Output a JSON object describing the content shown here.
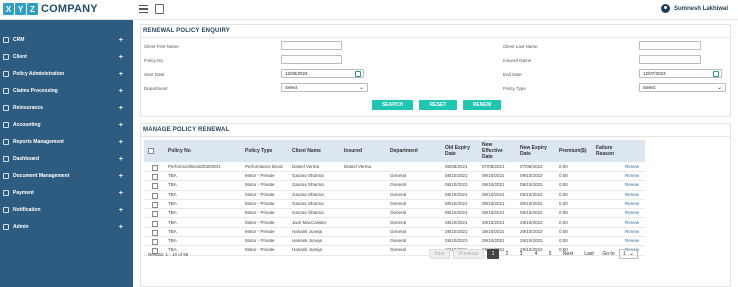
{
  "app": {
    "logo_letters": [
      "X",
      "Y",
      "Z"
    ],
    "logo_text": "COMPANY",
    "user_name": "Sumnesh Lakhiwal"
  },
  "sidebar": {
    "items": [
      {
        "label": "CRM"
      },
      {
        "label": "Client"
      },
      {
        "label": "Policy Administration"
      },
      {
        "label": "Claims Processing"
      },
      {
        "label": "Reinsurance"
      },
      {
        "label": "Accounting"
      },
      {
        "label": "Reports Management"
      },
      {
        "label": "Dashboard"
      },
      {
        "label": "Document Management"
      },
      {
        "label": "Payment"
      },
      {
        "label": "Notification"
      },
      {
        "label": "Admin"
      }
    ],
    "expand_symbol": "+"
  },
  "enquiry": {
    "title": "RENEWAL POLICY ENQUIRY",
    "fields": {
      "client_first_name": {
        "label": "Client First Name",
        "value": ""
      },
      "client_last_name": {
        "label": "Client Last Name",
        "value": ""
      },
      "policy_no": {
        "label": "Policy No",
        "value": ""
      },
      "insured_name": {
        "label": "Insured Name",
        "value": ""
      },
      "start_date": {
        "label": "Start Date",
        "value": "12/06/2023"
      },
      "end_date": {
        "label": "End Date",
        "value": "12/07/2023"
      },
      "department": {
        "label": "Department",
        "value": "Select"
      },
      "policy_type": {
        "label": "Policy Type",
        "value": "Select"
      }
    },
    "buttons": {
      "search": "SEARCH",
      "reset": "RESET",
      "renew": "RENEW"
    }
  },
  "manage": {
    "title": "MANAGE POLICY RENEWAL",
    "columns": [
      "Policy No",
      "Policy Type",
      "Client Name",
      "Insured",
      "Department",
      "Old Expiry Date",
      "New Effective Date",
      "New Expiry Date",
      "Premium($)",
      "Failure Reason"
    ],
    "rows": [
      {
        "policy_no": "Performce/Bond/2020/001",
        "policy_type": "Performance Bond",
        "client": "Daniel Verma",
        "insured": "Daniel Verma",
        "department": "",
        "old_expiry": "06/08/2021",
        "new_effective": "07/08/2021",
        "new_expiry": "07/08/2022",
        "premium": "0.00",
        "failure": "",
        "action": "Renew"
      },
      {
        "policy_no": "TBA",
        "policy_type": "Motor - Private",
        "client": "Gaurav Sharma",
        "insured": "",
        "department": "General",
        "old_expiry": "08/10/2021",
        "new_effective": "09/10/2021",
        "new_expiry": "09/10/2022",
        "premium": "0.00",
        "failure": "",
        "action": "Renew"
      },
      {
        "policy_no": "TBA",
        "policy_type": "Motor - Private",
        "client": "Gaurav Sharma",
        "insured": "",
        "department": "General",
        "old_expiry": "08/10/2021",
        "new_effective": "09/10/2021",
        "new_expiry": "09/10/2022",
        "premium": "0.00",
        "failure": "",
        "action": "Renew"
      },
      {
        "policy_no": "TBA",
        "policy_type": "Motor - Private",
        "client": "Gaurav Sharma",
        "insured": "",
        "department": "General",
        "old_expiry": "08/10/2021",
        "new_effective": "09/10/2021",
        "new_expiry": "09/10/2022",
        "premium": "0.00",
        "failure": "",
        "action": "Renew"
      },
      {
        "policy_no": "TBA",
        "policy_type": "Motor - Private",
        "client": "Gaurav Sharma",
        "insured": "",
        "department": "General",
        "old_expiry": "08/10/2021",
        "new_effective": "09/10/2021",
        "new_expiry": "09/10/2022",
        "premium": "0.00",
        "failure": "",
        "action": "Renew"
      },
      {
        "policy_no": "TBA",
        "policy_type": "Motor - Private",
        "client": "Gaurav Sharma",
        "insured": "",
        "department": "General",
        "old_expiry": "08/10/2021",
        "new_effective": "09/10/2021",
        "new_expiry": "09/10/2022",
        "premium": "0.00",
        "failure": "",
        "action": "Renew"
      },
      {
        "policy_no": "TBA",
        "policy_type": "Motor - Private",
        "client": "Jack MacCalister",
        "insured": "",
        "department": "General",
        "old_expiry": "28/10/2021",
        "new_effective": "29/10/2021",
        "new_expiry": "29/10/2022",
        "premium": "0.00",
        "failure": "",
        "action": "Renew"
      },
      {
        "policy_no": "TBA",
        "policy_type": "Motor - Private",
        "client": "Hariank Juneja",
        "insured": "",
        "department": "General",
        "old_expiry": "28/10/2021",
        "new_effective": "29/10/2021",
        "new_expiry": "29/10/2022",
        "premium": "0.00",
        "failure": "",
        "action": "Renew"
      },
      {
        "policy_no": "TBA",
        "policy_type": "Motor - Private",
        "client": "Hariank Juneja",
        "insured": "",
        "department": "General",
        "old_expiry": "28/10/2021",
        "new_effective": "29/10/2021",
        "new_expiry": "29/10/2022",
        "premium": "0.00",
        "failure": "",
        "action": "Renew"
      },
      {
        "policy_no": "TBA",
        "policy_type": "Motor - Private",
        "client": "Hariank Juneja",
        "insured": "",
        "department": "General",
        "old_expiry": "28/10/2021",
        "new_effective": "29/10/2021",
        "new_expiry": "29/10/2022",
        "premium": "0.00",
        "failure": "",
        "action": "Renew"
      }
    ]
  },
  "pagination": {
    "results_text": "Results: 1 - 10 of 95",
    "first": "First",
    "previous": "Previous",
    "pages": [
      "1",
      "2",
      "3",
      "4",
      "5"
    ],
    "current_page": "1",
    "next": "Next",
    "last": "Last",
    "goto_label": "Go to",
    "goto_value": "1"
  },
  "colors": {
    "sidebar_bg": "#2e5b80",
    "accent_button": "#1fc6b0",
    "table_header_bg": "#dbe6f0",
    "link": "#2d6ca2"
  }
}
